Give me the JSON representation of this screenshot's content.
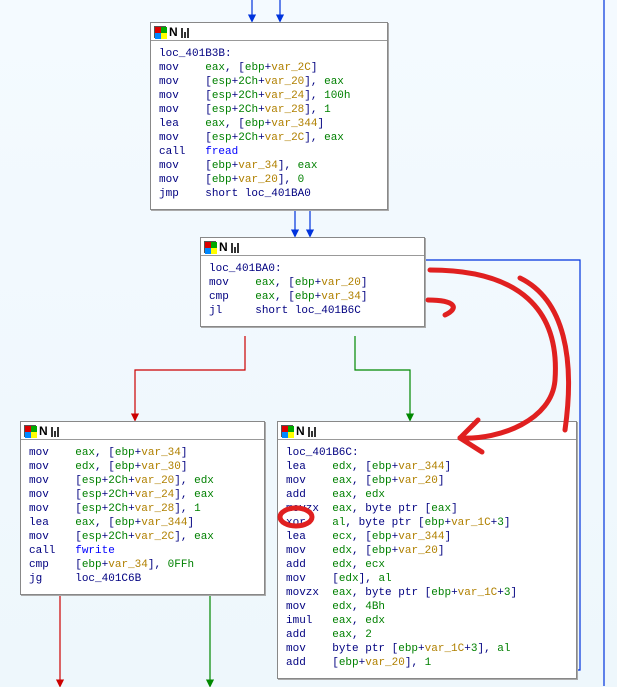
{
  "blocks": {
    "b1": {
      "label": "loc_401B3B:",
      "rows": [
        {
          "m": "mov",
          "o": [
            "eax",
            ", [",
            "ebp",
            "+",
            "var_2C",
            "]"
          ]
        },
        {
          "m": "mov",
          "o": [
            "[",
            "esp",
            "+",
            "2Ch",
            "+",
            "var_20",
            "], ",
            "eax"
          ]
        },
        {
          "m": "mov",
          "o": [
            "[",
            "esp",
            "+",
            "2Ch",
            "+",
            "var_24",
            "], ",
            "100h"
          ]
        },
        {
          "m": "mov",
          "o": [
            "[",
            "esp",
            "+",
            "2Ch",
            "+",
            "var_28",
            "], ",
            "1"
          ]
        },
        {
          "m": "lea",
          "o": [
            "eax",
            ", [",
            "ebp",
            "+",
            "var_344",
            "]"
          ]
        },
        {
          "m": "mov",
          "o": [
            "[",
            "esp",
            "+",
            "2Ch",
            "+",
            "var_2C",
            "], ",
            "eax"
          ]
        },
        {
          "m": "call",
          "o": [
            "fread"
          ],
          "fn": true
        },
        {
          "m": "mov",
          "o": [
            "[",
            "ebp",
            "+",
            "var_34",
            "], ",
            "eax"
          ]
        },
        {
          "m": "mov",
          "o": [
            "[",
            "ebp",
            "+",
            "var_20",
            "], ",
            "0"
          ]
        },
        {
          "m": "jmp",
          "o": [
            "short loc_401BA0"
          ]
        }
      ]
    },
    "b2": {
      "label": "loc_401BA0:",
      "rows": [
        {
          "m": "mov",
          "o": [
            "eax",
            ", [",
            "ebp",
            "+",
            "var_20",
            "]"
          ]
        },
        {
          "m": "cmp",
          "o": [
            "eax",
            ", [",
            "ebp",
            "+",
            "var_34",
            "]"
          ]
        },
        {
          "m": "jl",
          "o": [
            "short loc_401B6C"
          ]
        }
      ]
    },
    "b3": {
      "label": "",
      "rows": [
        {
          "m": "mov",
          "o": [
            "eax",
            ", [",
            "ebp",
            "+",
            "var_34",
            "]"
          ]
        },
        {
          "m": "mov",
          "o": [
            "edx",
            ", [",
            "ebp",
            "+",
            "var_30",
            "]"
          ]
        },
        {
          "m": "mov",
          "o": [
            "[",
            "esp",
            "+",
            "2Ch",
            "+",
            "var_20",
            "], ",
            "edx"
          ]
        },
        {
          "m": "mov",
          "o": [
            "[",
            "esp",
            "+",
            "2Ch",
            "+",
            "var_24",
            "], ",
            "eax"
          ]
        },
        {
          "m": "mov",
          "o": [
            "[",
            "esp",
            "+",
            "2Ch",
            "+",
            "var_28",
            "], ",
            "1"
          ]
        },
        {
          "m": "lea",
          "o": [
            "eax",
            ", [",
            "ebp",
            "+",
            "var_344",
            "]"
          ]
        },
        {
          "m": "mov",
          "o": [
            "[",
            "esp",
            "+",
            "2Ch",
            "+",
            "var_2C",
            "], ",
            "eax"
          ]
        },
        {
          "m": "call",
          "o": [
            "fwrite"
          ],
          "fn": true
        },
        {
          "m": "cmp",
          "o": [
            "[",
            "ebp",
            "+",
            "var_34",
            "], ",
            "0FFh"
          ]
        },
        {
          "m": "jg",
          "o": [
            "loc_401C6B"
          ]
        }
      ]
    },
    "b4": {
      "label": "loc_401B6C:",
      "rows": [
        {
          "m": "lea",
          "o": [
            "edx",
            ", [",
            "ebp",
            "+",
            "var_344",
            "]"
          ]
        },
        {
          "m": "mov",
          "o": [
            "eax",
            ", [",
            "ebp",
            "+",
            "var_20",
            "]"
          ]
        },
        {
          "m": "add",
          "o": [
            "eax",
            ", ",
            "edx"
          ]
        },
        {
          "m": "movzx",
          "o": [
            "eax",
            ", byte ptr [",
            "eax",
            "]"
          ]
        },
        {
          "m": "xor",
          "o": [
            "al",
            ", byte ptr [",
            "ebp",
            "+",
            "var_1C",
            "+",
            "3",
            "]"
          ]
        },
        {
          "m": "lea",
          "o": [
            "ecx",
            ", [",
            "ebp",
            "+",
            "var_344",
            "]"
          ]
        },
        {
          "m": "mov",
          "o": [
            "edx",
            ", [",
            "ebp",
            "+",
            "var_20",
            "]"
          ]
        },
        {
          "m": "add",
          "o": [
            "edx",
            ", ",
            "ecx"
          ]
        },
        {
          "m": "mov",
          "o": [
            "[",
            "edx",
            "], ",
            "al"
          ]
        },
        {
          "m": "movzx",
          "o": [
            "eax",
            ", byte ptr [",
            "ebp",
            "+",
            "var_1C",
            "+",
            "3",
            "]"
          ]
        },
        {
          "m": "mov",
          "o": [
            "edx",
            ", ",
            "4Bh"
          ]
        },
        {
          "m": "imul",
          "o": [
            "eax",
            ", ",
            "edx"
          ]
        },
        {
          "m": "add",
          "o": [
            "eax",
            ", ",
            "2"
          ]
        },
        {
          "m": "mov",
          "o": [
            "byte ptr [",
            "ebp",
            "+",
            "var_1C",
            "+",
            "3",
            "], ",
            "al"
          ]
        },
        {
          "m": "add",
          "o": [
            "[",
            "ebp",
            "+",
            "var_20",
            "], ",
            "1"
          ]
        }
      ]
    }
  }
}
